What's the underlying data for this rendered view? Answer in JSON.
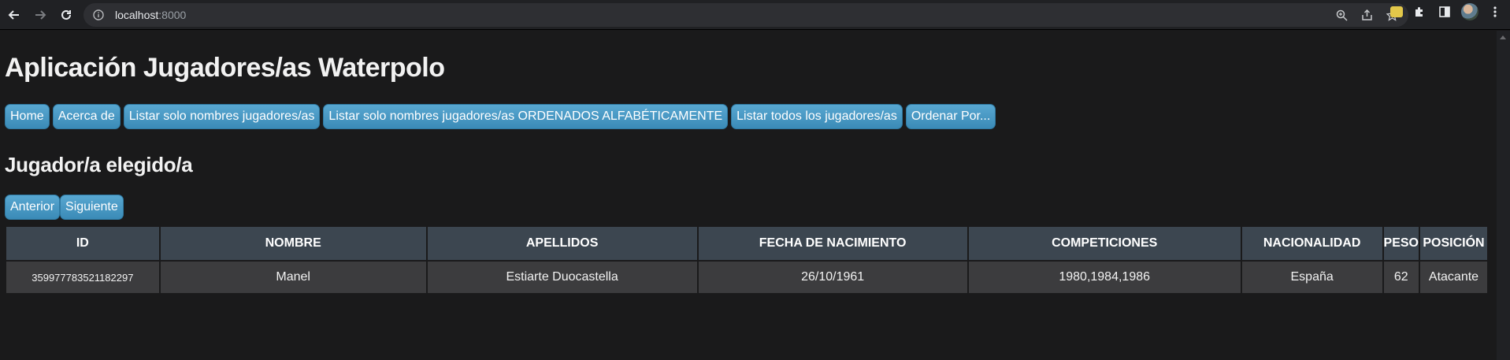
{
  "browser": {
    "url_host": "localhost",
    "url_port": ":8000"
  },
  "app": {
    "title": "Aplicación Jugadores/as Waterpolo",
    "menu": [
      {
        "label": "Home"
      },
      {
        "label": "Acerca de"
      },
      {
        "label": "Listar solo nombres jugadores/as"
      },
      {
        "label": "Listar solo nombres jugadores/as ORDENADOS ALFABÉTICAMENTE"
      },
      {
        "label": "Listar todos los jugadores/as"
      },
      {
        "label": "Ordenar Por..."
      }
    ],
    "section_title": "Jugador/a elegido/a",
    "pager": {
      "prev_label": "Anterior",
      "next_label": "Siguiente"
    },
    "table": {
      "headers": [
        "ID",
        "NOMBRE",
        "APELLIDOS",
        "FECHA DE NACIMIENTO",
        "COMPETICIONES",
        "NACIONALIDAD",
        "PESO",
        "POSICIÓN"
      ],
      "rows": [
        [
          "359977783521182297",
          "Manel",
          "Estiarte Duocastella",
          "26/10/1961",
          "1980,1984,1986",
          "España",
          "62",
          "Atacante"
        ]
      ]
    }
  },
  "colors": {
    "background": "#1a1a1b",
    "button": "#4a9ac6",
    "header_cell": "#3c4650",
    "body_cell": "#3c3c3e"
  }
}
